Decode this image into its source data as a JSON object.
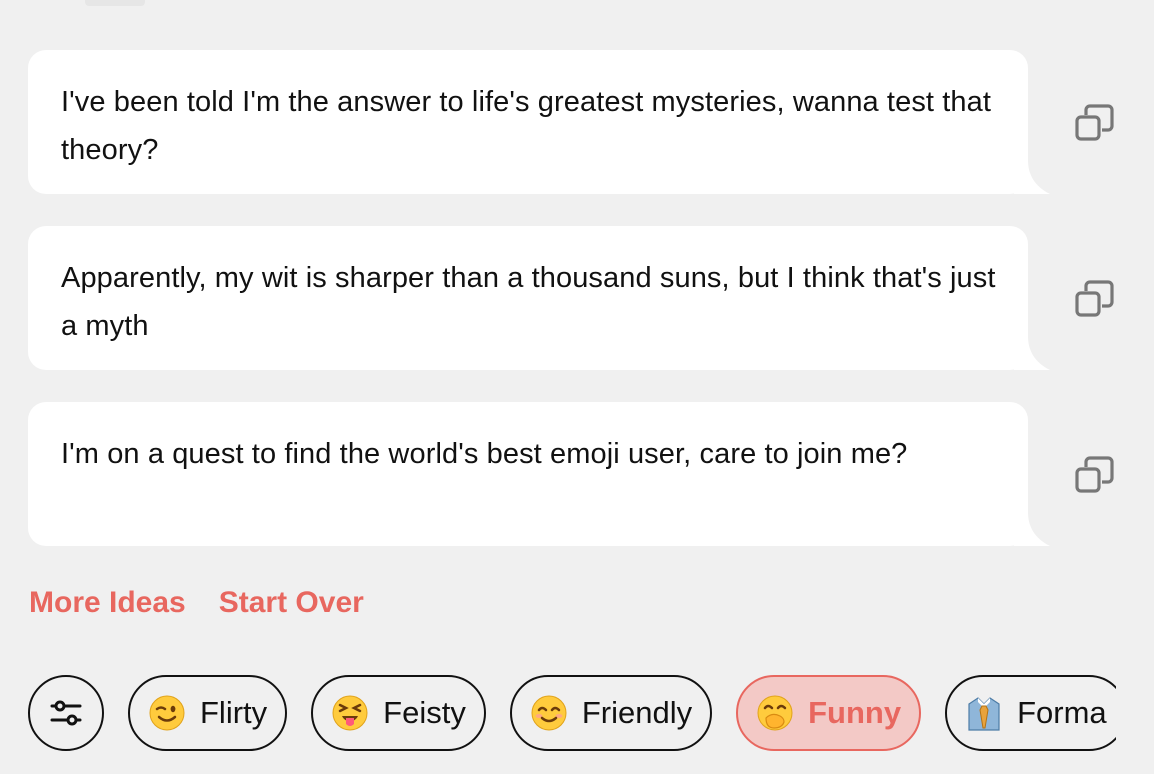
{
  "suggestions": [
    {
      "text": "I've been told I'm the answer to life's greatest mysteries, wanna test that theory?",
      "copy_icon": "copy-icon"
    },
    {
      "text": "Apparently, my wit is sharper than a thousand suns, but I think that's just a myth",
      "copy_icon": "copy-icon"
    },
    {
      "text": "I'm on a quest to find the world's best emoji user, care to join me?",
      "copy_icon": "copy-icon"
    }
  ],
  "actions": {
    "more_ideas": "More Ideas",
    "start_over": "Start Over"
  },
  "tones": {
    "settings_icon": "sliders-icon",
    "chips": [
      {
        "label": "Flirty",
        "icon": "winking-face-icon",
        "active": false
      },
      {
        "label": "Feisty",
        "icon": "squinting-tongue-face-icon",
        "active": false
      },
      {
        "label": "Friendly",
        "icon": "smiling-face-icon",
        "active": false
      },
      {
        "label": "Funny",
        "icon": "face-with-hand-over-mouth-icon",
        "active": true
      },
      {
        "label": "Forma",
        "icon": "necktie-shirt-icon",
        "active": false
      }
    ]
  },
  "colors": {
    "background": "#f0f0f0",
    "bubble": "#ffffff",
    "accent": "#e8675f",
    "active_chip_bg": "#f3c9c6"
  }
}
